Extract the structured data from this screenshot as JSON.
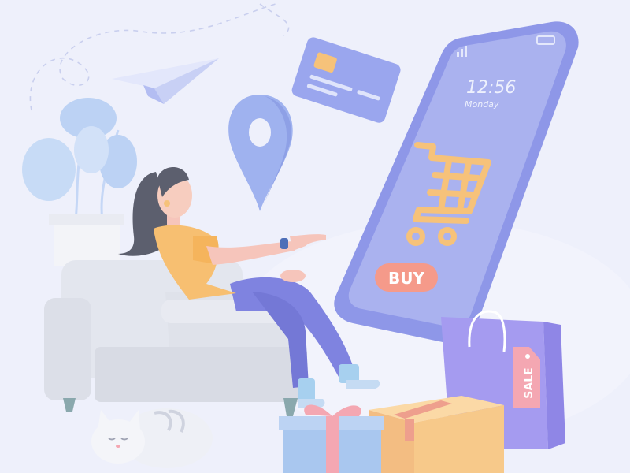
{
  "phone": {
    "time": "12:56",
    "day": "Monday",
    "buy_label": "BUY"
  },
  "bag": {
    "tag_label": "SALE"
  },
  "colors": {
    "background": "#eef0fb",
    "phone_body": "#8e97e8",
    "phone_screen": "#aab2ef",
    "cart": "#f6c27a",
    "buy_button": "#f59a8a",
    "bag": "#a59bf0",
    "box": "#f7c98a",
    "gift": "#a9c7ef",
    "ribbon": "#f4a7b2",
    "shirt": "#f7bf71",
    "pants": "#7f83e0",
    "chair": "#dfe2ea",
    "plant": "#bcd2f4"
  },
  "icons": [
    "paper-plane-icon",
    "credit-card-icon",
    "location-pin-icon",
    "shopping-cart-icon",
    "sale-tag-icon"
  ]
}
